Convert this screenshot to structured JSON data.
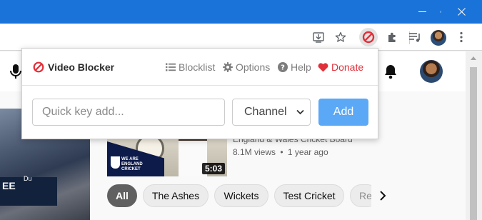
{
  "browser": {
    "toolbar": {
      "icons": [
        "install-app-icon",
        "bookmark-star-icon",
        "video-blocker-extension-icon",
        "extensions-puzzle-icon",
        "media-controls-icon",
        "profile-avatar",
        "menu-kebab-icon"
      ]
    },
    "window_controls": [
      "minimize-icon",
      "restore-icon",
      "close-icon"
    ]
  },
  "youtube": {
    "video": {
      "channel": "England & Wales Cricket Board",
      "views": "8.1M views",
      "separator": "•",
      "age": "1 year ago",
      "duration": "5:03",
      "thumbnail_text": [
        "WE ARE",
        "ENGLAND",
        "CRICKET"
      ]
    },
    "hero_text": "EE",
    "hero_small_text": "Du",
    "chips": [
      "All",
      "The Ashes",
      "Wickets",
      "Test Cricket",
      "Relat"
    ]
  },
  "popup": {
    "title": "Video Blocker",
    "nav": {
      "blocklist": "Blocklist",
      "options": "Options",
      "help": "Help",
      "donate": "Donate"
    },
    "quick_add": {
      "placeholder": "Quick key add...",
      "value": "",
      "type_selected": "Channel",
      "add_label": "Add"
    }
  },
  "colors": {
    "titlebar": "#1a73d9",
    "block_red": "#e0303a",
    "add_button": "#5ba8f7",
    "chip_active": "#606060"
  }
}
